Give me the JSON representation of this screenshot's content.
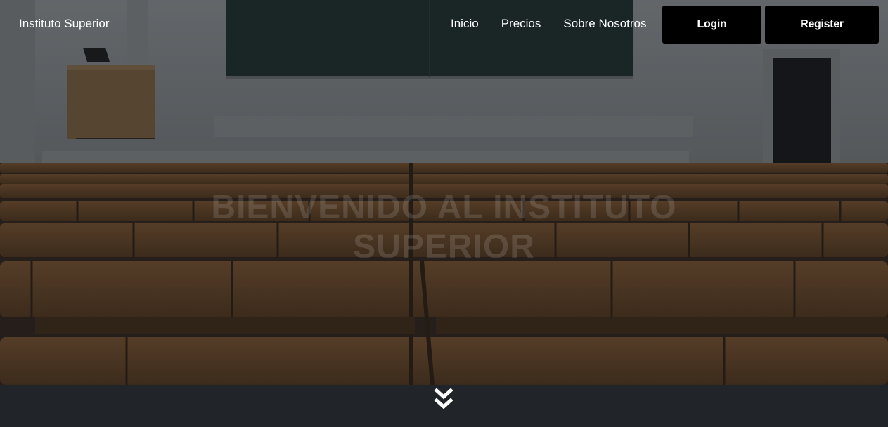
{
  "navbar": {
    "brand": "Instituto Superior",
    "links": [
      "Inicio",
      "Precios",
      "Sobre Nosotros"
    ],
    "login_label": "Login",
    "register_label": "Register"
  },
  "hero": {
    "title_line1": "Bienvenido al Instituto",
    "title_line2": "Superior"
  },
  "icons": {
    "scroll_down": "double-chevron-down-icon"
  },
  "colors": {
    "button_bg": "#000000",
    "footer_bg": "#212529",
    "text": "#ffffff"
  }
}
